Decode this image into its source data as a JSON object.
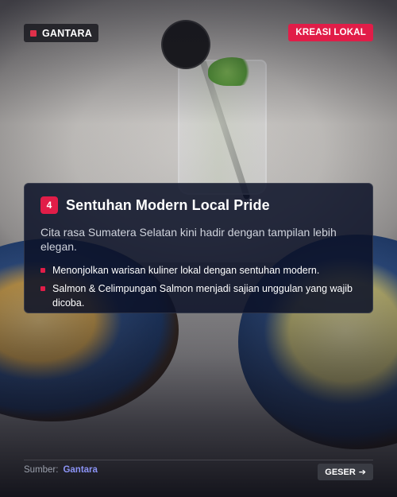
{
  "brand": {
    "label": "GANTARA",
    "accent": "#e0304a"
  },
  "category": {
    "label": "KREASI LOKAL",
    "color": "#e11d48"
  },
  "slide": {
    "number": "4",
    "title": "Sentuhan Modern Local Pride",
    "subtitle": "Cita rasa Sumatera Selatan kini hadir dengan tampilan lebih elegan.",
    "bullets": [
      "Menonjolkan warisan kuliner lokal dengan sentuhan modern.",
      "Salmon & Celimpungan Salmon menjadi sajian unggulan yang wajib dicoba."
    ]
  },
  "footer": {
    "source_label": "Sumber:",
    "source_name": "Gantara",
    "next_label": "GESER",
    "next_icon": "arrow-right-icon"
  }
}
